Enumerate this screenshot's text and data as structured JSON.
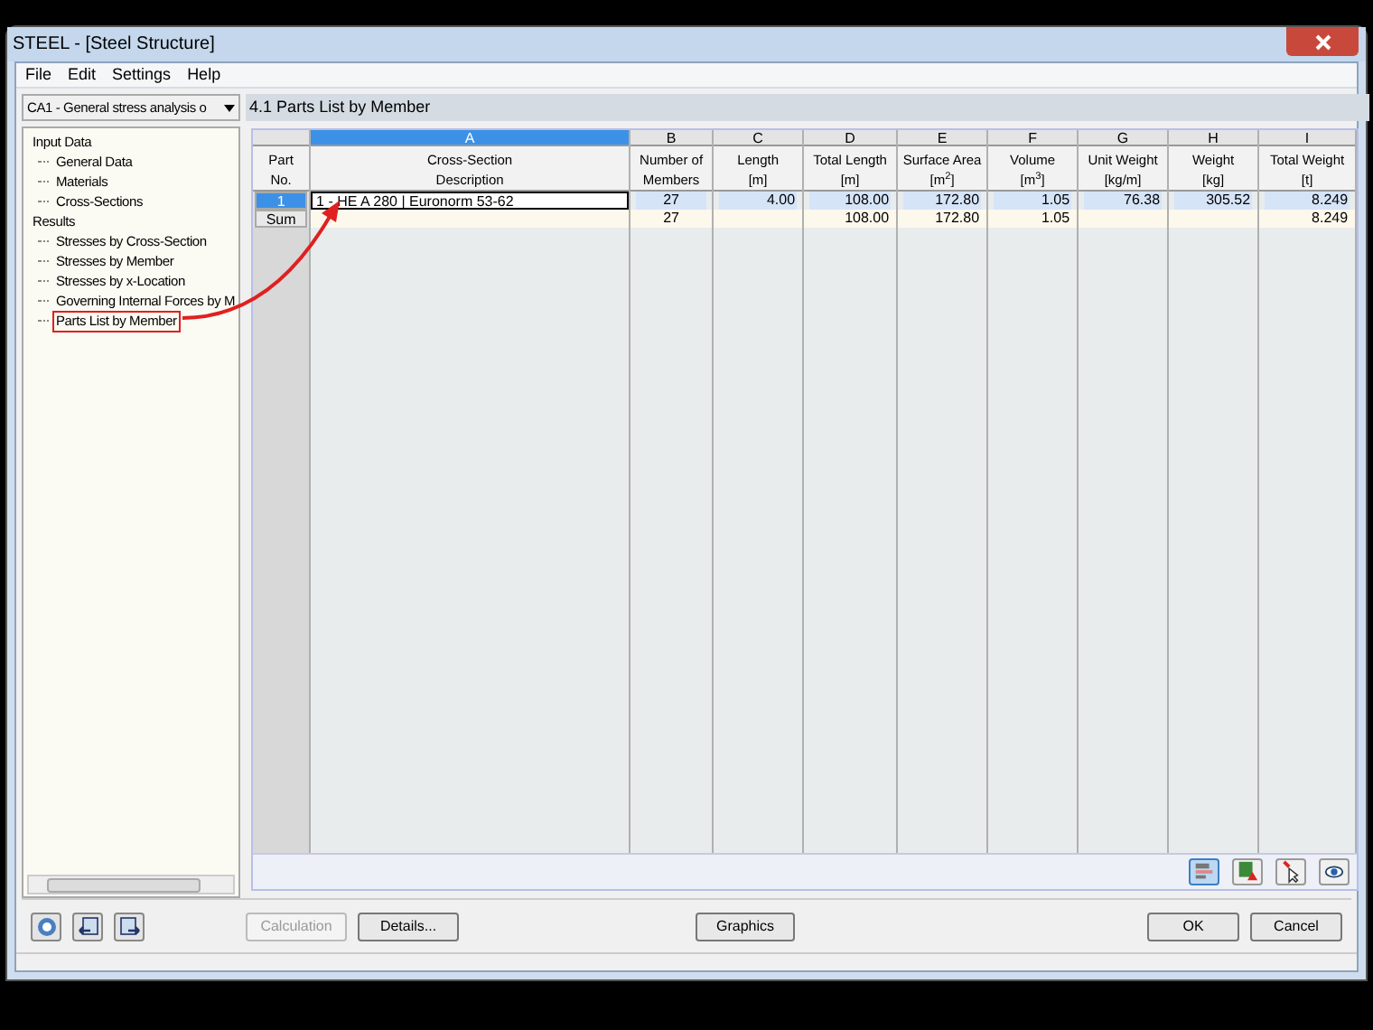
{
  "window": {
    "title": "STEEL - [Steel Structure]"
  },
  "menu": [
    "File",
    "Edit",
    "Settings",
    "Help"
  ],
  "case_dropdown": {
    "value": "CA1 - General stress analysis o"
  },
  "tree": [
    {
      "label": "Input Data",
      "selected": false,
      "children": [
        {
          "label": "General Data",
          "selected": false
        },
        {
          "label": "Materials",
          "selected": false
        },
        {
          "label": "Cross-Sections",
          "selected": false
        }
      ]
    },
    {
      "label": "Results",
      "selected": false,
      "children": [
        {
          "label": "Stresses by Cross-Section",
          "selected": false
        },
        {
          "label": "Stresses by Member",
          "selected": false
        },
        {
          "label": "Stresses by x-Location",
          "selected": false
        },
        {
          "label": "Governing Internal Forces by M",
          "selected": false
        },
        {
          "label": "Parts List by Member",
          "selected": true
        }
      ]
    }
  ],
  "panel_title": "4.1 Parts List by Member",
  "table": {
    "columns": [
      {
        "line1": "Part",
        "line2": "No.",
        "selected": false
      },
      {
        "letter": "A",
        "line1": "Cross-Section",
        "line2": "Description",
        "selected": true
      },
      {
        "letter": "B",
        "line1": "Number of",
        "line2": "Members",
        "selected": false
      },
      {
        "letter": "C",
        "line1": "Length",
        "line2": "[m]",
        "selected": false
      },
      {
        "letter": "D",
        "line1": "Total Length",
        "line2": "[m]",
        "selected": false
      },
      {
        "letter": "E",
        "line1": "Surface Area",
        "line2": "[m$^{2}$]",
        "selected": false
      },
      {
        "letter": "F",
        "line1": "Volume",
        "line2": "[m$^{3}$]",
        "selected": false
      },
      {
        "letter": "G",
        "line1": "Unit Weight",
        "line2": "[kg/m]",
        "selected": false
      },
      {
        "letter": "H",
        "line1": "Weight",
        "line2": "[kg]",
        "selected": false
      },
      {
        "letter": "I",
        "line1": "Total Weight",
        "line2": "[t]",
        "selected": false
      }
    ],
    "rows": [
      {
        "kind": "part",
        "selected": true,
        "cells": [
          "1",
          "1 - HE A 280 | Euronorm 53-62",
          "27",
          "4.00",
          "108.00",
          "172.80",
          "1.05",
          "76.38",
          "305.52",
          "8.249"
        ]
      },
      {
        "kind": "sum",
        "selected": false,
        "cells": [
          "Sum",
          "",
          "27",
          "",
          "108.00",
          "172.80",
          "1.05",
          "",
          "",
          "8.249"
        ]
      }
    ]
  },
  "buttons": {
    "calculation": {
      "label": "Calculation",
      "disabled": true
    },
    "details": {
      "label": "Details...",
      "disabled": false
    },
    "graphics": {
      "label": "Graphics",
      "disabled": false
    },
    "ok": {
      "label": "OK",
      "disabled": false
    },
    "cancel": {
      "label": "Cancel",
      "disabled": false
    }
  }
}
